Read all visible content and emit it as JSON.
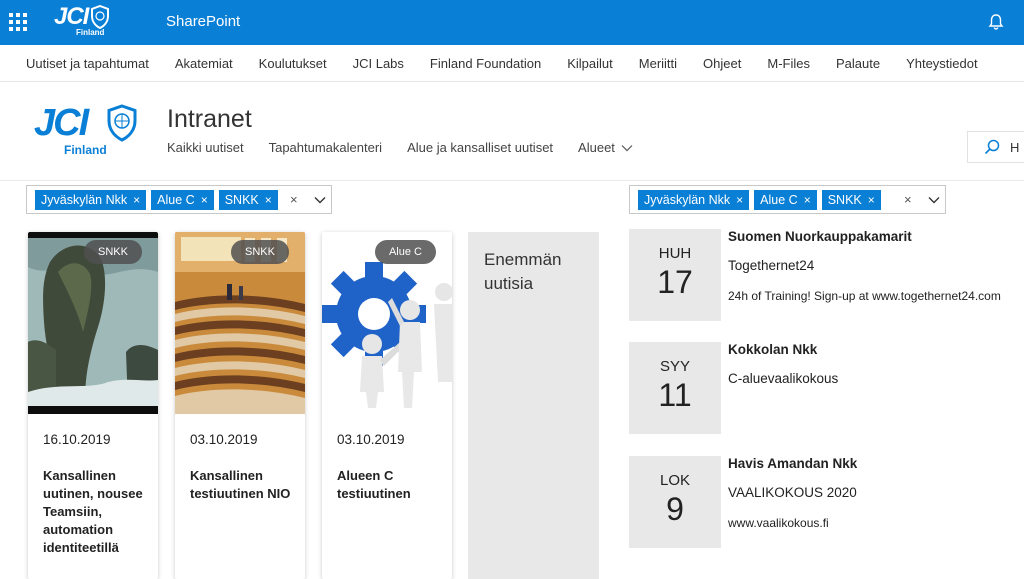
{
  "suitebar": {
    "logo_text": "JCI",
    "logo_sub": "Finland",
    "app_name": "SharePoint"
  },
  "hub_nav": [
    "Uutiset ja tapahtumat",
    "Akatemiat",
    "Koulutukset",
    "JCI Labs",
    "Finland Foundation",
    "Kilpailut",
    "Meriitti",
    "Ohjeet",
    "M-Files",
    "Palaute",
    "Yhteystiedot"
  ],
  "site": {
    "logo_text": "JCI",
    "logo_sub": "Finland",
    "title": "Intranet",
    "nav": [
      "Kaikki uutiset",
      "Tapahtumakalenteri",
      "Alue ja kansalliset uutiset",
      "Alueet"
    ],
    "search_placeholder": "H"
  },
  "news_filter": {
    "chips": [
      "Jyväskylän Nkk",
      "Alue C",
      "SNKK"
    ],
    "clear": "×"
  },
  "events_filter": {
    "chips": [
      "Jyväskylän Nkk",
      "Alue C",
      "SNKK"
    ],
    "clear": "×"
  },
  "news": [
    {
      "badge": "SNKK",
      "date": "16.10.2019",
      "title": "Kansallinen uutinen, nousee Teamsiin, automation identiteetillä"
    },
    {
      "badge": "SNKK",
      "date": "03.10.2019",
      "title": "Kansallinen testiuutinen NIO"
    },
    {
      "badge": "Alue C",
      "date": "03.10.2019",
      "title": "Alueen C testiuutinen"
    }
  ],
  "more_news": "Enemmän uutisia",
  "events": [
    {
      "month": "HUH",
      "day": "17",
      "org": "Suomen Nuorkauppakamarit",
      "name": "Togethernet24",
      "location": "24h of Training! Sign-up at www.togethernet24.com"
    },
    {
      "month": "SYY",
      "day": "11",
      "org": "Kokkolan Nkk",
      "name": "C-aluevaalikokous",
      "location": ""
    },
    {
      "month": "LOK",
      "day": "9",
      "org": "Havis Amandan Nkk",
      "name": "VAALIKOKOUS 2020",
      "location": "www.vaalikokous.fi"
    }
  ],
  "colors": {
    "brand_blue": "#0a7fd6",
    "tile_gray": "#e8e8e8"
  }
}
